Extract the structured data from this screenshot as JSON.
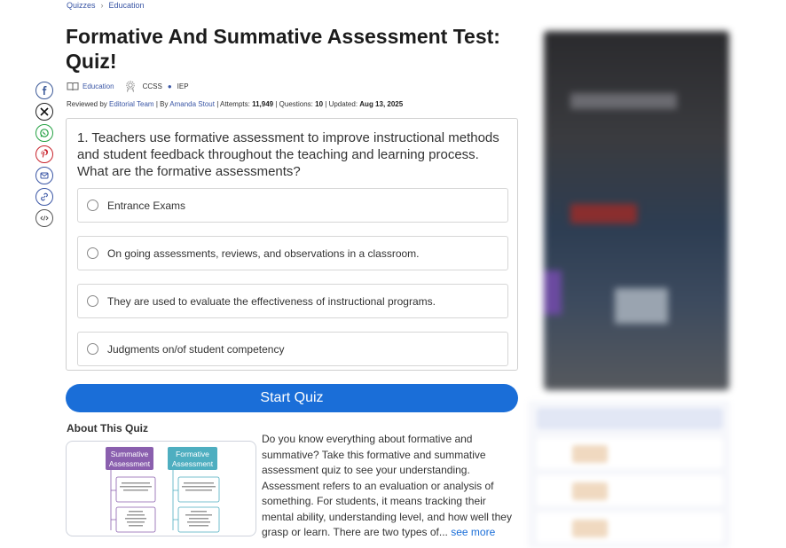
{
  "breadcrumb": {
    "items": [
      "Quizzes",
      "Education"
    ],
    "separator": "›"
  },
  "title": "Formative And Summative Assessment Test: Quiz!",
  "meta": {
    "category": "Education",
    "tag1": "CCSS",
    "tag2": "IEP",
    "reviewed_prefix": "Reviewed by",
    "reviewer": "Editorial Team",
    "by_prefix": "| By",
    "author": "Amanda Stout",
    "attempts_label": "| Attempts:",
    "attempts": "11,949",
    "questions_label": "| Questions:",
    "questions": "10",
    "updated_label": "| Updated:",
    "updated": "Aug 13, 2025"
  },
  "share_icons": [
    "facebook-icon",
    "x-icon",
    "whatsapp-icon",
    "pinterest-icon",
    "email-icon",
    "link-icon",
    "embed-icon"
  ],
  "question": {
    "text": "1. Teachers use formative assessment to improve instructional methods and student feedback throughout the teaching and learning process. What are the formative assessments?",
    "options": [
      "Entrance Exams",
      "On going assessments, reviews, and observations in a classroom.",
      "They are used to evaluate the effectiveness of instructional programs.",
      "Judgments on/of student competency"
    ]
  },
  "start_button": "Start Quiz",
  "about": {
    "heading": "About This Quiz",
    "text": "Do you know everything about formative and summative? Take this formative and summative assessment quiz to see your understanding. Assessment refers to an evaluation or analysis of something. For students, it means tracking their mental ability, understanding level, and how well they grasp or learn. There are two types of... ",
    "see_more": "see more",
    "image": {
      "left_header": "Summative Assessment",
      "right_header": "Formative Assessment",
      "left_color": "#8a5fae",
      "right_color": "#4eaec0"
    }
  },
  "colors": {
    "accent": "#1a6ed8",
    "link": "#3a56a5"
  }
}
